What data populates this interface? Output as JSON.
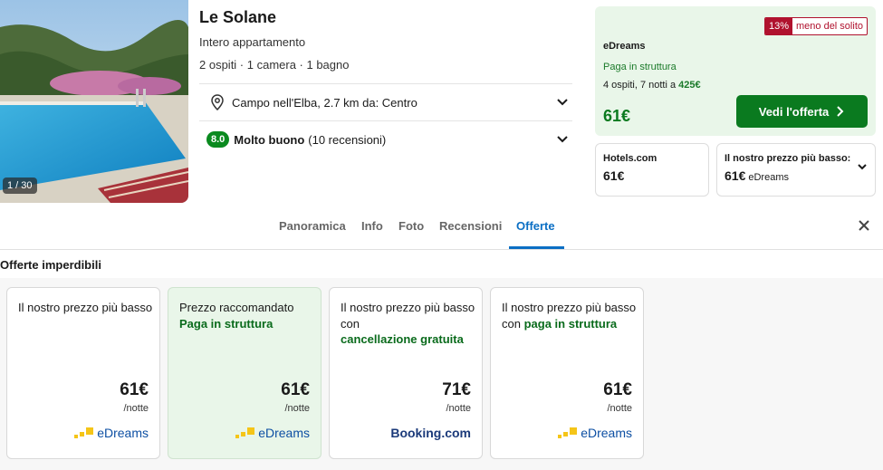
{
  "photo": {
    "counter": "1 / 30"
  },
  "hotel": {
    "name": "Le Solane",
    "type": "Intero appartamento",
    "rooms": "2 ospiti · 1 camera · 1 bagno",
    "location": "Campo nell'Elba, 2.7 km da: Centro",
    "score": "8.0",
    "rating_label": "Molto buono",
    "reviews": "(10 recensioni)"
  },
  "main_offer": {
    "badge_pct": "13%",
    "badge_text": "meno del solito",
    "provider": "eDreams",
    "pay": "Paga in struttura",
    "stay_prefix": "4 ospiti, 7 notti a",
    "stay_total": "425€",
    "price": "61€",
    "button_label": "Vedi l'offerta"
  },
  "sub_offers": [
    {
      "provider": "Hotels.com",
      "price": "61€"
    },
    {
      "provider": "Il nostro prezzo più basso:",
      "price": "61€",
      "source": "eDreams"
    }
  ],
  "tabs": [
    {
      "label": "Panoramica"
    },
    {
      "label": "Info"
    },
    {
      "label": "Foto"
    },
    {
      "label": "Recensioni"
    },
    {
      "label": "Offerte"
    }
  ],
  "active_tab": "Offerte",
  "deals": {
    "title": "Offerte imperdibili",
    "per_night": "/notte",
    "cards": [
      {
        "title_plain": "Il nostro prezzo più basso",
        "title_bold": "",
        "price": "61€",
        "provider": "eDreams"
      },
      {
        "title_plain": "Prezzo raccomandato",
        "title_bold": "Paga in struttura",
        "price": "61€",
        "provider": "eDreams"
      },
      {
        "title_plain": "Il nostro prezzo più basso con",
        "title_bold": "cancellazione gratuita",
        "price": "71€",
        "provider": "Booking.com"
      },
      {
        "title_plain": "Il nostro prezzo più basso con",
        "title_bold": "paga in struttura",
        "price": "61€",
        "provider": "eDreams"
      }
    ]
  },
  "colors": {
    "accent_green": "#0a7a1f",
    "active_blue": "#0b6fc4",
    "badge_red": "#b0122e"
  },
  "icons": [
    "location-pin-icon",
    "chevron-down-icon",
    "chevron-right-icon",
    "close-icon",
    "edreams-logo-icon"
  ]
}
